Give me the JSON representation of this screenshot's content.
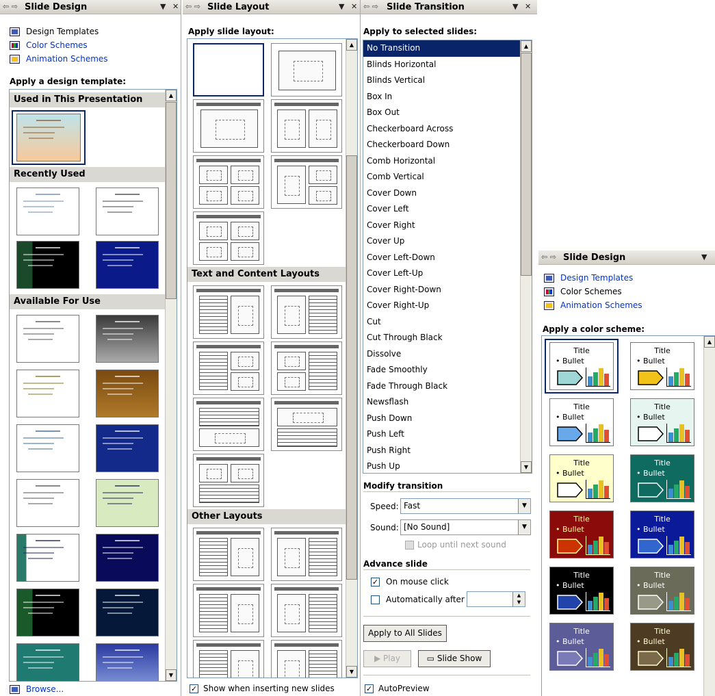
{
  "pane1": {
    "title": "Slide Design",
    "links": {
      "design_templates": "Design Templates",
      "color_schemes": "Color Schemes",
      "animation_schemes": "Animation Schemes"
    },
    "heading": "Apply a design template:",
    "sections": {
      "used": "Used in This Presentation",
      "recent": "Recently Used",
      "available": "Available For Use"
    },
    "browse": "Browse..."
  },
  "pane2": {
    "title": "Slide Layout",
    "heading": "Apply slide layout:",
    "sections": {
      "text_content": "Text and Content Layouts",
      "other": "Other Layouts"
    },
    "show_when_inserting": "Show when inserting new slides"
  },
  "pane3": {
    "title": "Slide Transition",
    "heading": "Apply to selected slides:",
    "transitions": [
      "No Transition",
      "Blinds Horizontal",
      "Blinds Vertical",
      "Box In",
      "Box Out",
      "Checkerboard Across",
      "Checkerboard Down",
      "Comb Horizontal",
      "Comb Vertical",
      "Cover Down",
      "Cover Left",
      "Cover Right",
      "Cover Up",
      "Cover Left-Down",
      "Cover Left-Up",
      "Cover Right-Down",
      "Cover Right-Up",
      "Cut",
      "Cut Through Black",
      "Dissolve",
      "Fade Smoothly",
      "Fade Through Black",
      "Newsflash",
      "Push Down",
      "Push Left",
      "Push Right",
      "Push Up"
    ],
    "selected_transition": "No Transition",
    "modify_heading": "Modify transition",
    "speed_label": "Speed:",
    "speed_value": "Fast",
    "sound_label": "Sound:",
    "sound_value": "[No Sound]",
    "loop_label": "Loop until next sound",
    "advance_heading": "Advance slide",
    "on_mouse_click": "On mouse click",
    "on_mouse_click_checked": true,
    "auto_after": "Automatically after",
    "auto_after_checked": false,
    "apply_all": "Apply to All Slides",
    "play": "Play",
    "slide_show": "Slide Show",
    "autopreview": "AutoPreview",
    "autopreview_checked": true
  },
  "pane4": {
    "title": "Slide Design",
    "links": {
      "design_templates": "Design Templates",
      "color_schemes": "Color Schemes",
      "animation_schemes": "Animation Schemes"
    },
    "heading": "Apply a color scheme:",
    "swatch_title": "Title",
    "swatch_bullet": "• Bullet",
    "schemes": [
      {
        "bg": "#ffffff",
        "text": "#000000",
        "accent": "#9fd7d7"
      },
      {
        "bg": "#ffffff",
        "text": "#000000",
        "accent": "#f2c21b"
      },
      {
        "bg": "#ffffff",
        "text": "#000000",
        "accent": "#6aa9e9"
      },
      {
        "bg": "#e6f5f0",
        "text": "#000000",
        "accent": "#ffffff"
      },
      {
        "bg": "#ffffcc",
        "text": "#000000",
        "accent": "#ffffff"
      },
      {
        "bg": "#0f6b60",
        "text": "#ffffff",
        "accent": "#0f6b60"
      },
      {
        "bg": "#8b0a0a",
        "text": "#ffff99",
        "accent": "#cc3300"
      },
      {
        "bg": "#0a1a99",
        "text": "#ffffff",
        "accent": "#3366cc"
      },
      {
        "bg": "#000000",
        "text": "#ffffff",
        "accent": "#2244aa"
      },
      {
        "bg": "#6b6b5a",
        "text": "#ffffff",
        "accent": "#999988"
      },
      {
        "bg": "#5c5c99",
        "text": "#ffffff",
        "accent": "#7a7ab8"
      },
      {
        "bg": "#4d3b24",
        "text": "#ffffcc",
        "accent": "#7a6a4a"
      }
    ]
  },
  "colors": {
    "selection": "#0a246a",
    "link": "#0033cc",
    "section_bg": "#d9d8d2"
  }
}
